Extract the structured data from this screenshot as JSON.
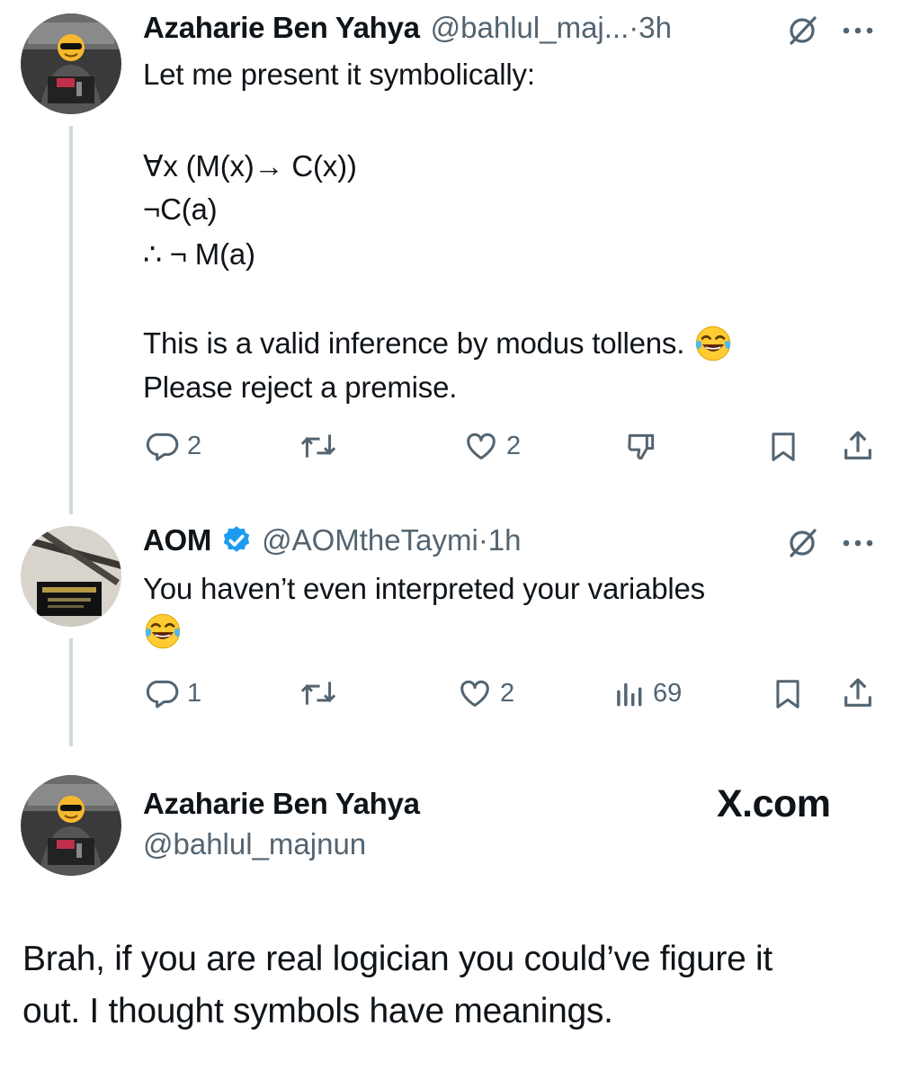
{
  "tweet1": {
    "author_name": "Azaharie Ben Yahya",
    "author_handle": "@bahlul_maj...",
    "dot_time": "·3h",
    "lines": [
      "Let me present it symbolically:",
      "∀x (M(x)→ C(x))",
      "¬C(a)",
      "∴ ¬ M(a)",
      "This is a valid inference by modus tollens.",
      "Please reject a premise."
    ],
    "stats": {
      "replies": "2",
      "likes": "2"
    },
    "icons": [
      "grok-slash-icon",
      "more-icon",
      "reply-icon",
      "retweet-icon",
      "like-icon",
      "dislike-icon",
      "bookmark-icon",
      "share-icon"
    ]
  },
  "tweet2": {
    "author_name": "AOM",
    "author_handle": "@AOMtheTaymi",
    "dot_time": "·1h",
    "lines": [
      "You haven’t even interpreted your variables"
    ],
    "stats": {
      "replies": "1",
      "likes": "2",
      "views": "69"
    },
    "icons": [
      "verified-badge-icon",
      "grok-slash-icon",
      "more-icon",
      "reply-icon",
      "retweet-icon",
      "like-icon",
      "views-icon",
      "bookmark-icon",
      "share-icon"
    ]
  },
  "tweet3": {
    "author_name": "Azaharie Ben Yahya",
    "author_handle": "@bahlul_majnun",
    "brand": "X.com",
    "lines": [
      "Brah, if you are real logician you could’ve figure it",
      "out. I thought symbols have meanings."
    ]
  },
  "colors": {
    "text": "#0f1419",
    "secondary": "#536471",
    "thread_line": "#cfd9de",
    "verified": "#1d9bf0"
  }
}
